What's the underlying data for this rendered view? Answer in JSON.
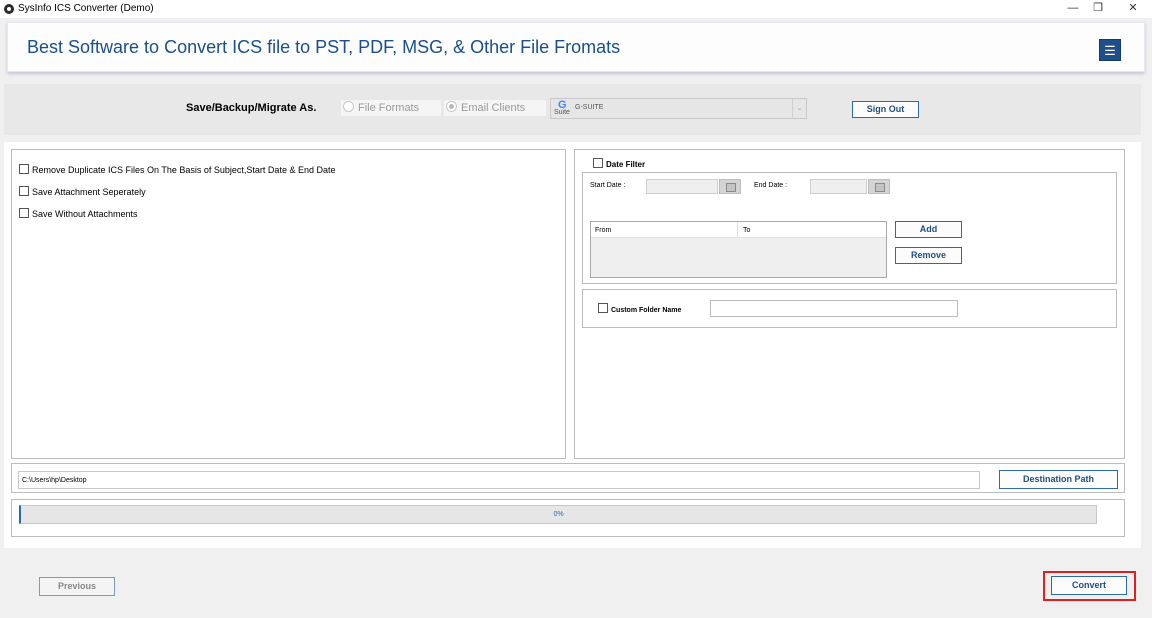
{
  "window": {
    "title": "SysInfo ICS Converter (Demo)",
    "controls": {
      "minimize": "—",
      "restore": "❐",
      "close": "✕"
    }
  },
  "banner": {
    "title": "Best Software to Convert ICS file to PST, PDF, MSG, & Other File Fromats",
    "menu_icon": "hamburger-icon",
    "menu_glyph": "☰"
  },
  "save_options": {
    "label": "Save/Backup/Migrate As.",
    "radio_file_formats": "File Formats",
    "radio_email_clients": "Email Clients",
    "selected_radio": "Email Clients",
    "select_logo_g": "G",
    "select_logo_suite": "Suite",
    "select_value": "G-SUITE",
    "select_arrow": "⌄",
    "sign_out": "Sign Out"
  },
  "options": [
    "Remove Duplicate ICS Files On The Basis of Subject,Start Date & End Date",
    "Save Attachment Seperately",
    "Save Without Attachments"
  ],
  "date_filter": {
    "label": "Date Filter",
    "start_date_label": "Start Date :",
    "end_date_label": "End Date :",
    "columns": [
      "From",
      "To"
    ],
    "add": "Add",
    "remove": "Remove"
  },
  "custom_folder": {
    "label": "Custom Folder Name",
    "value": ""
  },
  "destination": {
    "path": "C:\\Users\\hp\\Desktop",
    "button": "Destination Path"
  },
  "progress": {
    "percent": 0,
    "label": "0%"
  },
  "footer": {
    "previous": "Previous",
    "convert": "Convert"
  },
  "colors": {
    "accent": "#1e4f8b",
    "title_blue": "#1a4f8b",
    "highlight": "#e02020"
  }
}
